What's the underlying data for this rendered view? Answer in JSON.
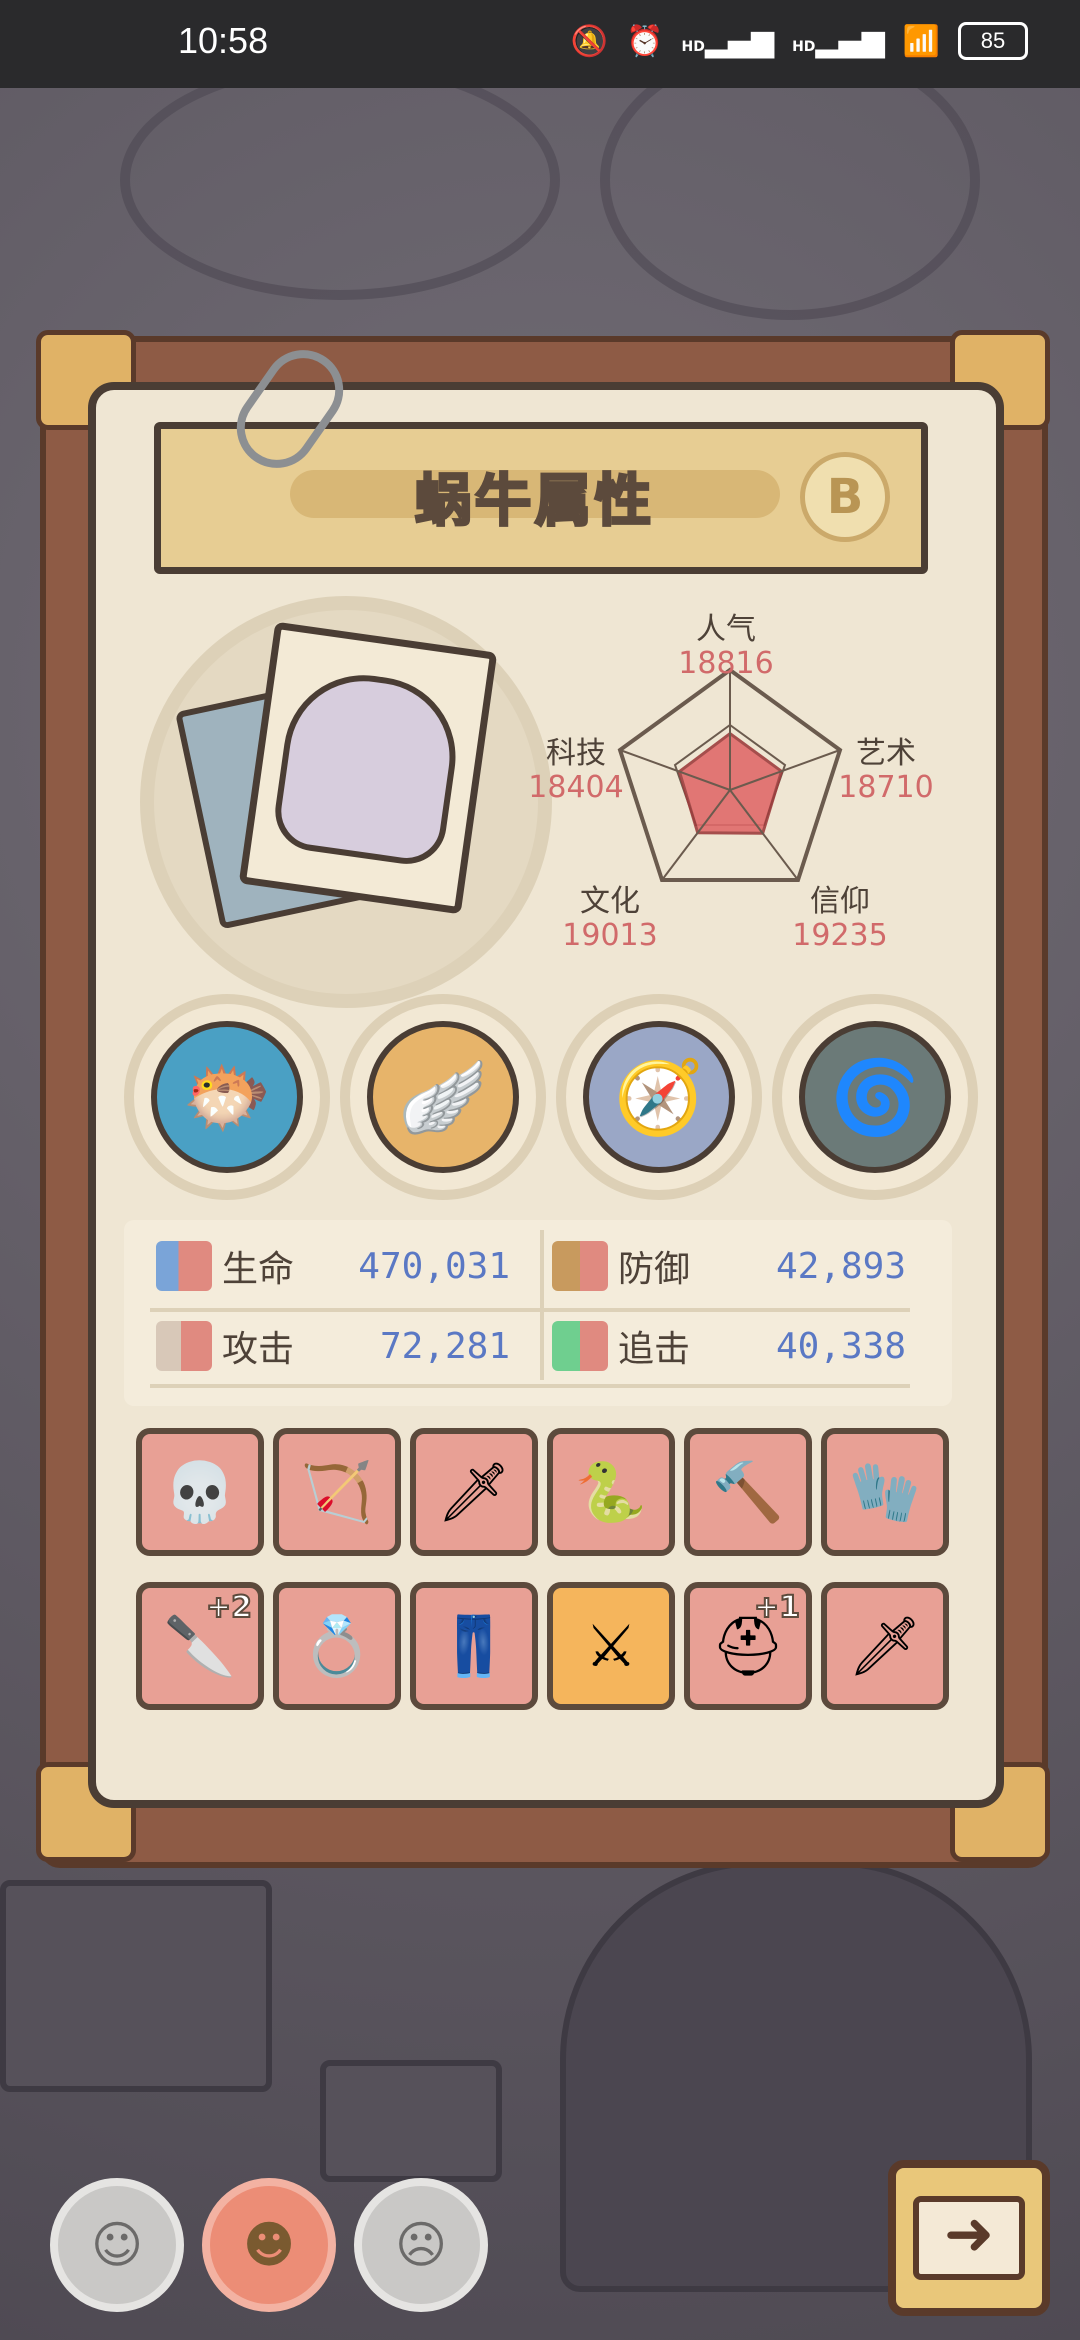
{
  "status_bar": {
    "time": "10:58",
    "battery": "85",
    "icons": [
      "mute-icon",
      "alarm-icon",
      "signal-hd-icon",
      "signal-hd-icon",
      "wifi-icon"
    ],
    "hd_label": "HD"
  },
  "panel": {
    "title": "蜗牛属性",
    "grade_badge": "B"
  },
  "radar": {
    "stats": [
      {
        "label": "人气",
        "value": "18816"
      },
      {
        "label": "艺术",
        "value": "18710"
      },
      {
        "label": "信仰",
        "value": "19235"
      },
      {
        "label": "文化",
        "value": "19013"
      },
      {
        "label": "科技",
        "value": "18404"
      }
    ],
    "colors": {
      "fill": "#e06a6a",
      "grid": "#6b5b4e"
    }
  },
  "equipment": [
    {
      "icon": "sea-creature-icon",
      "glyph": "🐡",
      "color": "#4aa0c4"
    },
    {
      "icon": "winged-helmet-icon",
      "glyph": "🪽",
      "color": "#e7b46a"
    },
    {
      "icon": "compass-icon",
      "glyph": "🧭",
      "color": "#9aa7c6"
    },
    {
      "icon": "portal-ring-icon",
      "glyph": "🌀",
      "color": "#6b7a78"
    }
  ],
  "attributes": [
    {
      "label": "生命",
      "value": "470,031",
      "icon": "health-bar-icon"
    },
    {
      "label": "防御",
      "value": "42,893",
      "icon": "defense-bar-icon"
    },
    {
      "label": "攻击",
      "value": "72,281",
      "icon": "attack-bar-icon"
    },
    {
      "label": "追击",
      "value": "40,338",
      "icon": "pursuit-bar-icon"
    }
  ],
  "items": [
    {
      "icon": "skull-staff-icon",
      "glyph": "💀",
      "plus": ""
    },
    {
      "icon": "crossbow-icon",
      "glyph": "🏹",
      "plus": ""
    },
    {
      "icon": "rocket-sword-icon",
      "glyph": "🗡",
      "plus": ""
    },
    {
      "icon": "serpent-staff-icon",
      "glyph": "🐍",
      "plus": ""
    },
    {
      "icon": "hammer-icon",
      "glyph": "🔨",
      "plus": ""
    },
    {
      "icon": "gauntlet-icon",
      "glyph": "🧤",
      "plus": ""
    },
    {
      "icon": "dagger-icon",
      "glyph": "🔪",
      "plus": "+2"
    },
    {
      "icon": "ring-icon",
      "glyph": "💍",
      "plus": ""
    },
    {
      "icon": "pants-icon",
      "glyph": "👖",
      "plus": ""
    },
    {
      "icon": "jewel-sword-icon",
      "glyph": "⚔",
      "plus": "",
      "highlight": true
    },
    {
      "icon": "helmet-icon",
      "glyph": "⛑",
      "plus": "+1"
    },
    {
      "icon": "blue-sword-icon",
      "glyph": "🗡",
      "plus": ""
    }
  ],
  "bottom_nav": [
    {
      "icon": "snail-face-icon-1",
      "glyph": "☺",
      "active": false
    },
    {
      "icon": "snail-face-icon-2",
      "glyph": "☻",
      "active": true
    },
    {
      "icon": "snail-face-icon-3",
      "glyph": "☹",
      "active": false
    }
  ],
  "next_button": {
    "icon": "arrow-right-icon",
    "glyph": "➜"
  }
}
